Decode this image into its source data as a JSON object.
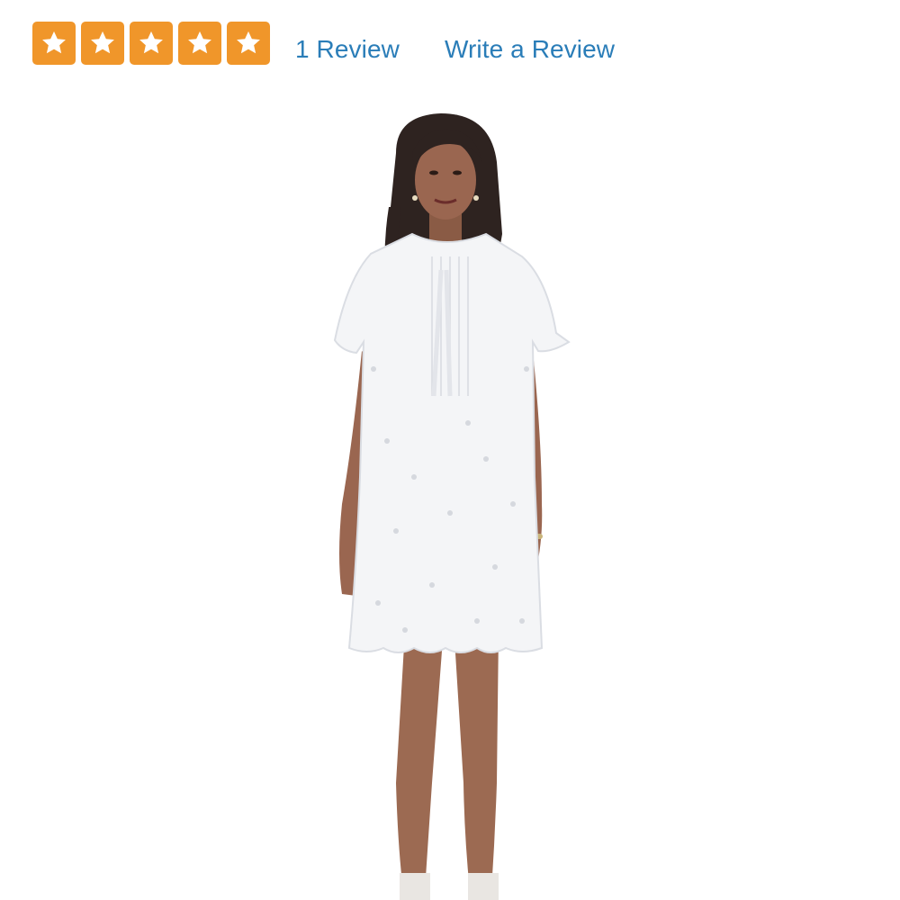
{
  "rating": {
    "stars_filled": 5,
    "stars_total": 5,
    "star_color": "#f0962a",
    "star_icon": "star-icon",
    "review_count_text": "1 Review",
    "write_review_text": "Write a Review",
    "link_color": "#2a7db8"
  },
  "product": {
    "image_icon": "product-photo-white-eyelet-dress"
  }
}
